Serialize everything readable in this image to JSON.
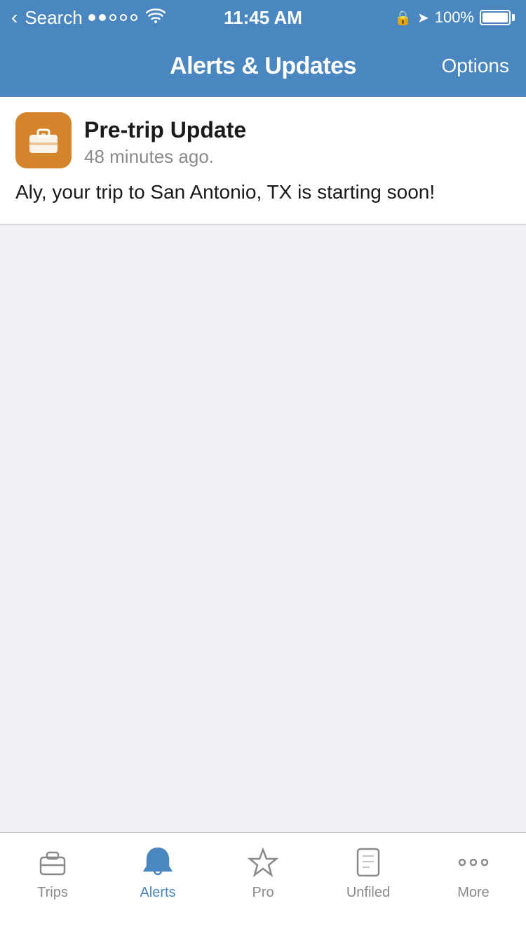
{
  "status_bar": {
    "back_label": "Search",
    "time": "11:45 AM",
    "battery_percent": "100%"
  },
  "nav_bar": {
    "title": "Alerts & Updates",
    "options_label": "Options"
  },
  "alert": {
    "title": "Pre-trip Update",
    "time": "48 minutes ago.",
    "body": "Aly, your trip to San Antonio, TX is starting soon!"
  },
  "tabs": [
    {
      "id": "trips",
      "label": "Trips",
      "active": false
    },
    {
      "id": "alerts",
      "label": "Alerts",
      "active": true
    },
    {
      "id": "pro",
      "label": "Pro",
      "active": false
    },
    {
      "id": "unfiled",
      "label": "Unfiled",
      "active": false
    },
    {
      "id": "more",
      "label": "More",
      "active": false
    }
  ]
}
